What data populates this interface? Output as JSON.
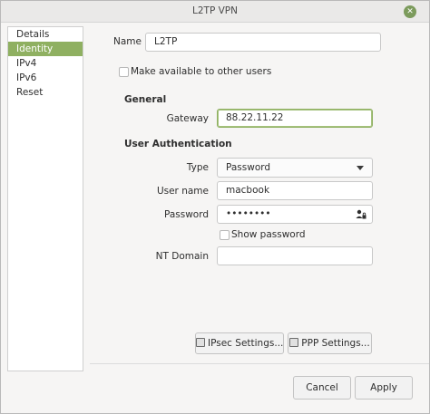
{
  "window": {
    "title": "L2TP VPN"
  },
  "sidebar": {
    "items": [
      {
        "label": "Details"
      },
      {
        "label": "Identity"
      },
      {
        "label": "IPv4"
      },
      {
        "label": "IPv6"
      },
      {
        "label": "Reset"
      }
    ],
    "selected": "Identity"
  },
  "identity": {
    "name_label": "Name",
    "name_value": "L2TP",
    "make_available_label": "Make available to other users",
    "make_available_checked": false,
    "general_heading": "General",
    "gateway_label": "Gateway",
    "gateway_value": "88.22.11.22",
    "auth_heading": "User Authentication",
    "type_label": "Type",
    "type_value": "Password",
    "username_label": "User name",
    "username_value": "macbook",
    "password_label": "Password",
    "password_value": "••••••••",
    "show_password_label": "Show password",
    "show_password_checked": false,
    "ntdomain_label": "NT Domain",
    "ntdomain_value": "",
    "ipsec_button": "IPsec Settings...",
    "ppp_button": "PPP Settings..."
  },
  "footer": {
    "cancel_label": "Cancel",
    "apply_label": "Apply"
  },
  "colors": {
    "accent": "#8fb061",
    "window_bg": "#f6f5f4"
  },
  "icons": {
    "close": "close-icon",
    "password_storage": "user-lock-icon",
    "button_settings": "settings-icon"
  }
}
